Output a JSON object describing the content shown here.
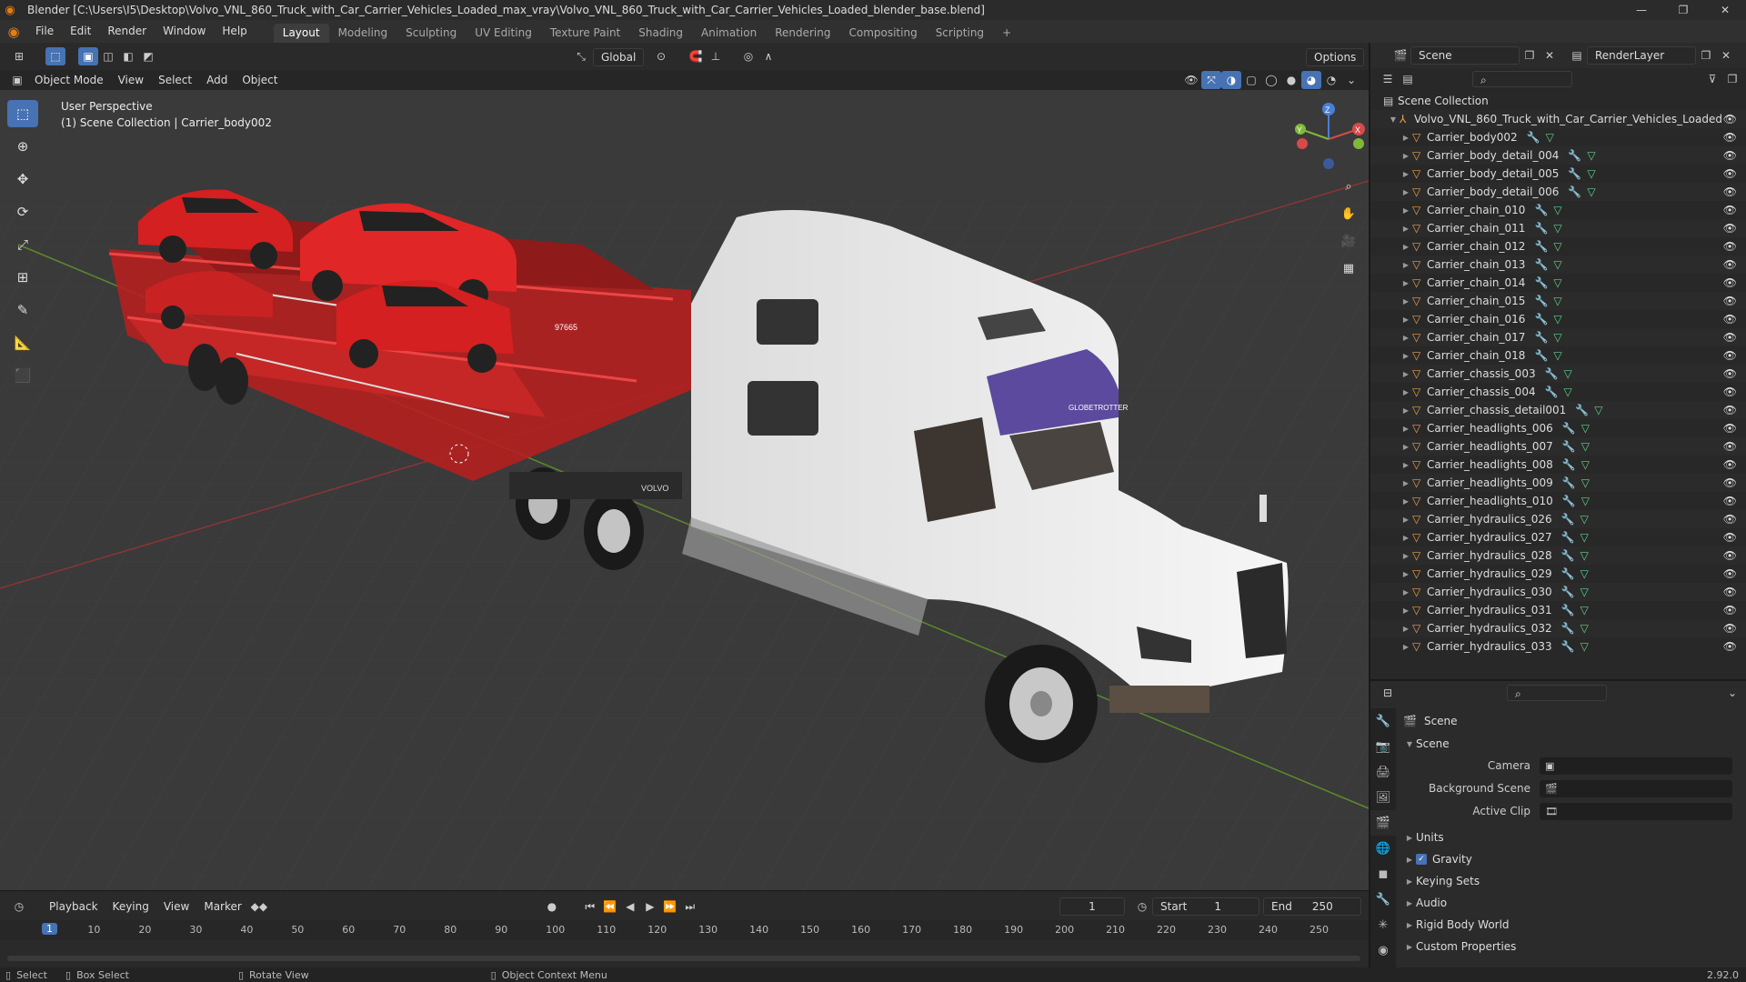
{
  "titlebar": {
    "title": "Blender [C:\\Users\\I5\\Desktop\\Volvo_VNL_860_Truck_with_Car_Carrier_Vehicles_Loaded_max_vray\\Volvo_VNL_860_Truck_with_Car_Carrier_Vehicles_Loaded_blender_base.blend]"
  },
  "menu": {
    "items": [
      "File",
      "Edit",
      "Render",
      "Window",
      "Help"
    ]
  },
  "workspaces": [
    "Layout",
    "Modeling",
    "Sculpting",
    "UV Editing",
    "Texture Paint",
    "Shading",
    "Animation",
    "Rendering",
    "Compositing",
    "Scripting"
  ],
  "scene": {
    "name": "Scene",
    "render_layer": "RenderLayer"
  },
  "tooltop": {
    "orientation": "Global",
    "options": "Options"
  },
  "header3d": {
    "mode": "Object Mode",
    "items": [
      "View",
      "Select",
      "Add",
      "Object"
    ]
  },
  "viewport": {
    "perspective": "User Perspective",
    "context": "(1) Scene Collection | Carrier_body002",
    "truck_brand": "VOLVO",
    "trailer_id": "97665",
    "cab_text": "GLOBETROTTER"
  },
  "gizmo": {
    "x": "X",
    "y": "Y",
    "z": "Z"
  },
  "outliner": {
    "root": "Scene Collection",
    "collection": "Volvo_VNL_860_Truck_with_Car_Carrier_Vehicles_Loaded",
    "objects": [
      "Carrier_body002",
      "Carrier_body_detail_004",
      "Carrier_body_detail_005",
      "Carrier_body_detail_006",
      "Carrier_chain_010",
      "Carrier_chain_011",
      "Carrier_chain_012",
      "Carrier_chain_013",
      "Carrier_chain_014",
      "Carrier_chain_015",
      "Carrier_chain_016",
      "Carrier_chain_017",
      "Carrier_chain_018",
      "Carrier_chassis_003",
      "Carrier_chassis_004",
      "Carrier_chassis_detail001",
      "Carrier_headlights_006",
      "Carrier_headlights_007",
      "Carrier_headlights_008",
      "Carrier_headlights_009",
      "Carrier_headlights_010",
      "Carrier_hydraulics_026",
      "Carrier_hydraulics_027",
      "Carrier_hydraulics_028",
      "Carrier_hydraulics_029",
      "Carrier_hydraulics_030",
      "Carrier_hydraulics_031",
      "Carrier_hydraulics_032",
      "Carrier_hydraulics_033"
    ]
  },
  "properties": {
    "context": "Scene",
    "panel": "Scene",
    "camera_label": "Camera",
    "bg_label": "Background Scene",
    "clip_label": "Active Clip",
    "sections": [
      "Units",
      "Gravity",
      "Keying Sets",
      "Audio",
      "Rigid Body World",
      "Custom Properties"
    ]
  },
  "timeline": {
    "menus": [
      "Playback",
      "Keying",
      "View",
      "Marker"
    ],
    "current_frame": "1",
    "start_label": "Start",
    "start": "1",
    "end_label": "End",
    "end": "250",
    "ticks": [
      "10",
      "20",
      "30",
      "40",
      "50",
      "60",
      "70",
      "80",
      "90",
      "100",
      "110",
      "120",
      "130",
      "140",
      "150",
      "160",
      "170",
      "180",
      "190",
      "200",
      "210",
      "220",
      "230",
      "240",
      "250"
    ]
  },
  "status": {
    "select": "Select",
    "box_select": "Box Select",
    "rotate": "Rotate View",
    "context_menu": "Object Context Menu",
    "version": "2.92.0"
  },
  "colors": {
    "accent": "#4772b3",
    "object_orange": "#e8a14e",
    "truck_red": "#c81e1e",
    "car_red": "#d42020",
    "cab_purple": "#5b4a9e"
  }
}
